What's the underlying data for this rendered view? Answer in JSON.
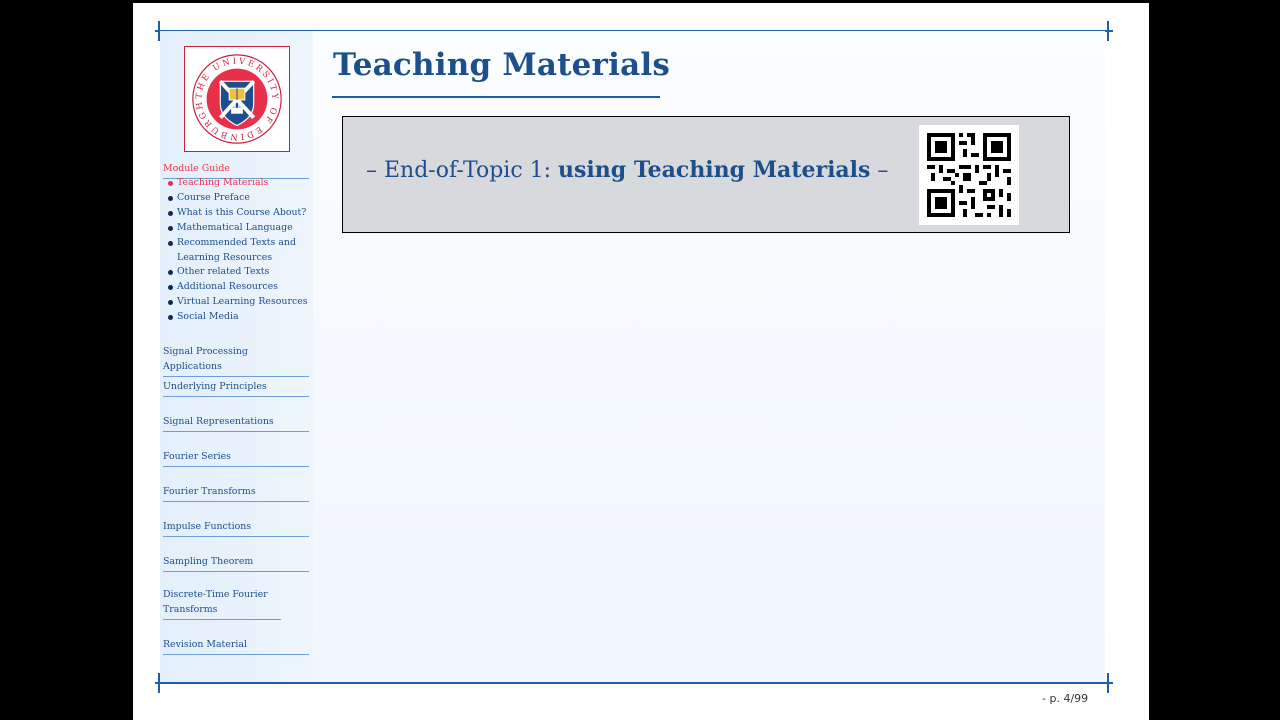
{
  "slide": {
    "title": "Teaching Materials",
    "box": {
      "prefix": "– End-of-Topic 1: ",
      "emphasis": "using Teaching Materials",
      "suffix": " –"
    },
    "page_number": "- p. 4/99"
  },
  "logo": {
    "text": "THE UNIVERSITY OF EDINBURGH",
    "colors": {
      "ring": "#e8304a",
      "shield": "#1d4f8c"
    }
  },
  "sidebar": {
    "module_guide": "Module Guide",
    "items": [
      {
        "label": "Teaching Materials",
        "active": true
      },
      {
        "label": "Course Preface",
        "active": false
      },
      {
        "label": "What is this Course About?",
        "active": false
      },
      {
        "label": "Mathematical Language",
        "active": false
      },
      {
        "label": "Recommended Texts and Learning Resources",
        "active": false
      },
      {
        "label": "Other related Texts",
        "active": false
      },
      {
        "label": "Additional Resources",
        "active": false
      },
      {
        "label": "Virtual Learning Resources",
        "active": false
      },
      {
        "label": "Social Media",
        "active": false
      }
    ],
    "sections": [
      "Signal Processing Applications",
      "Underlying Principles",
      "Signal Representations",
      "Fourier Series",
      "Fourier Transforms",
      "Impulse Functions",
      "Sampling Theorem",
      "Discrete-Time Fourier Transforms",
      "Revision Material"
    ]
  },
  "colors": {
    "accent": "#1d4f8c",
    "active": "#e8304a",
    "rule": "#1f5fa8",
    "box_bg": "#d7d9dc"
  }
}
